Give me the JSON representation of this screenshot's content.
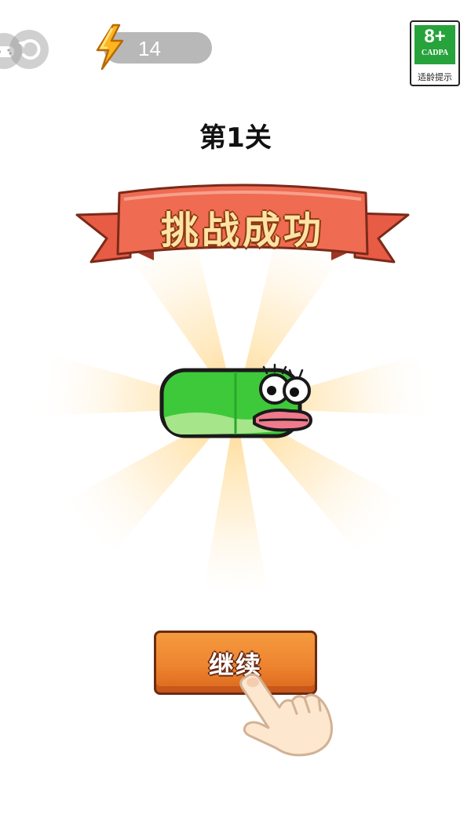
{
  "hud": {
    "energy_count": "14",
    "age_rating": {
      "number": "8+",
      "org": "CADPA",
      "note": "适龄提示"
    }
  },
  "level": {
    "title": "第1关"
  },
  "banner": {
    "text": "挑战成功"
  },
  "actions": {
    "continue_label": "继续"
  },
  "colors": {
    "ribbon": "#ee6a52",
    "button": "#ee8430",
    "caterpillar": "#3ec93a",
    "energy_pill": "#b8b8b8",
    "age_green": "#27a33b"
  },
  "icons": [
    "game-icon",
    "back-icon",
    "lightning-bolt-icon",
    "caterpillar",
    "pointing-hand-icon"
  ]
}
